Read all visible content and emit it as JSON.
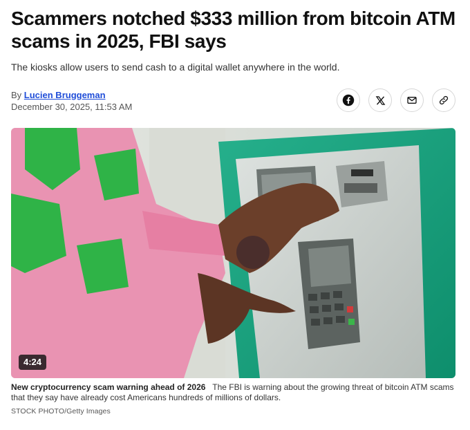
{
  "article": {
    "headline": "Scammers notched $333 million from bitcoin ATM scams in 2025, FBI says",
    "subhead": "The kiosks allow users to send cash to a digital wallet anywhere in the world.",
    "byline_prefix": "By",
    "author": "Lucien Bruggeman",
    "date": "December 30, 2025, 11:53 AM"
  },
  "share": {
    "buttons": [
      {
        "icon": "facebook-icon"
      },
      {
        "icon": "x-icon"
      },
      {
        "icon": "mail-icon"
      },
      {
        "icon": "link-icon"
      }
    ]
  },
  "video": {
    "duration": "4:24",
    "caption_title": "New cryptocurrency scam warning ahead of 2026",
    "caption_text": "The FBI is warning about the growing threat of bitcoin ATM scams that they say have already cost Americans hundreds of millions of dollars.",
    "credit": "STOCK PHOTO/Getty Images"
  },
  "colors": {
    "link": "#1f4dd8",
    "atm_green": "#17a882",
    "sweater_pink": "#e993b2",
    "sweater_green": "#2fb347"
  }
}
